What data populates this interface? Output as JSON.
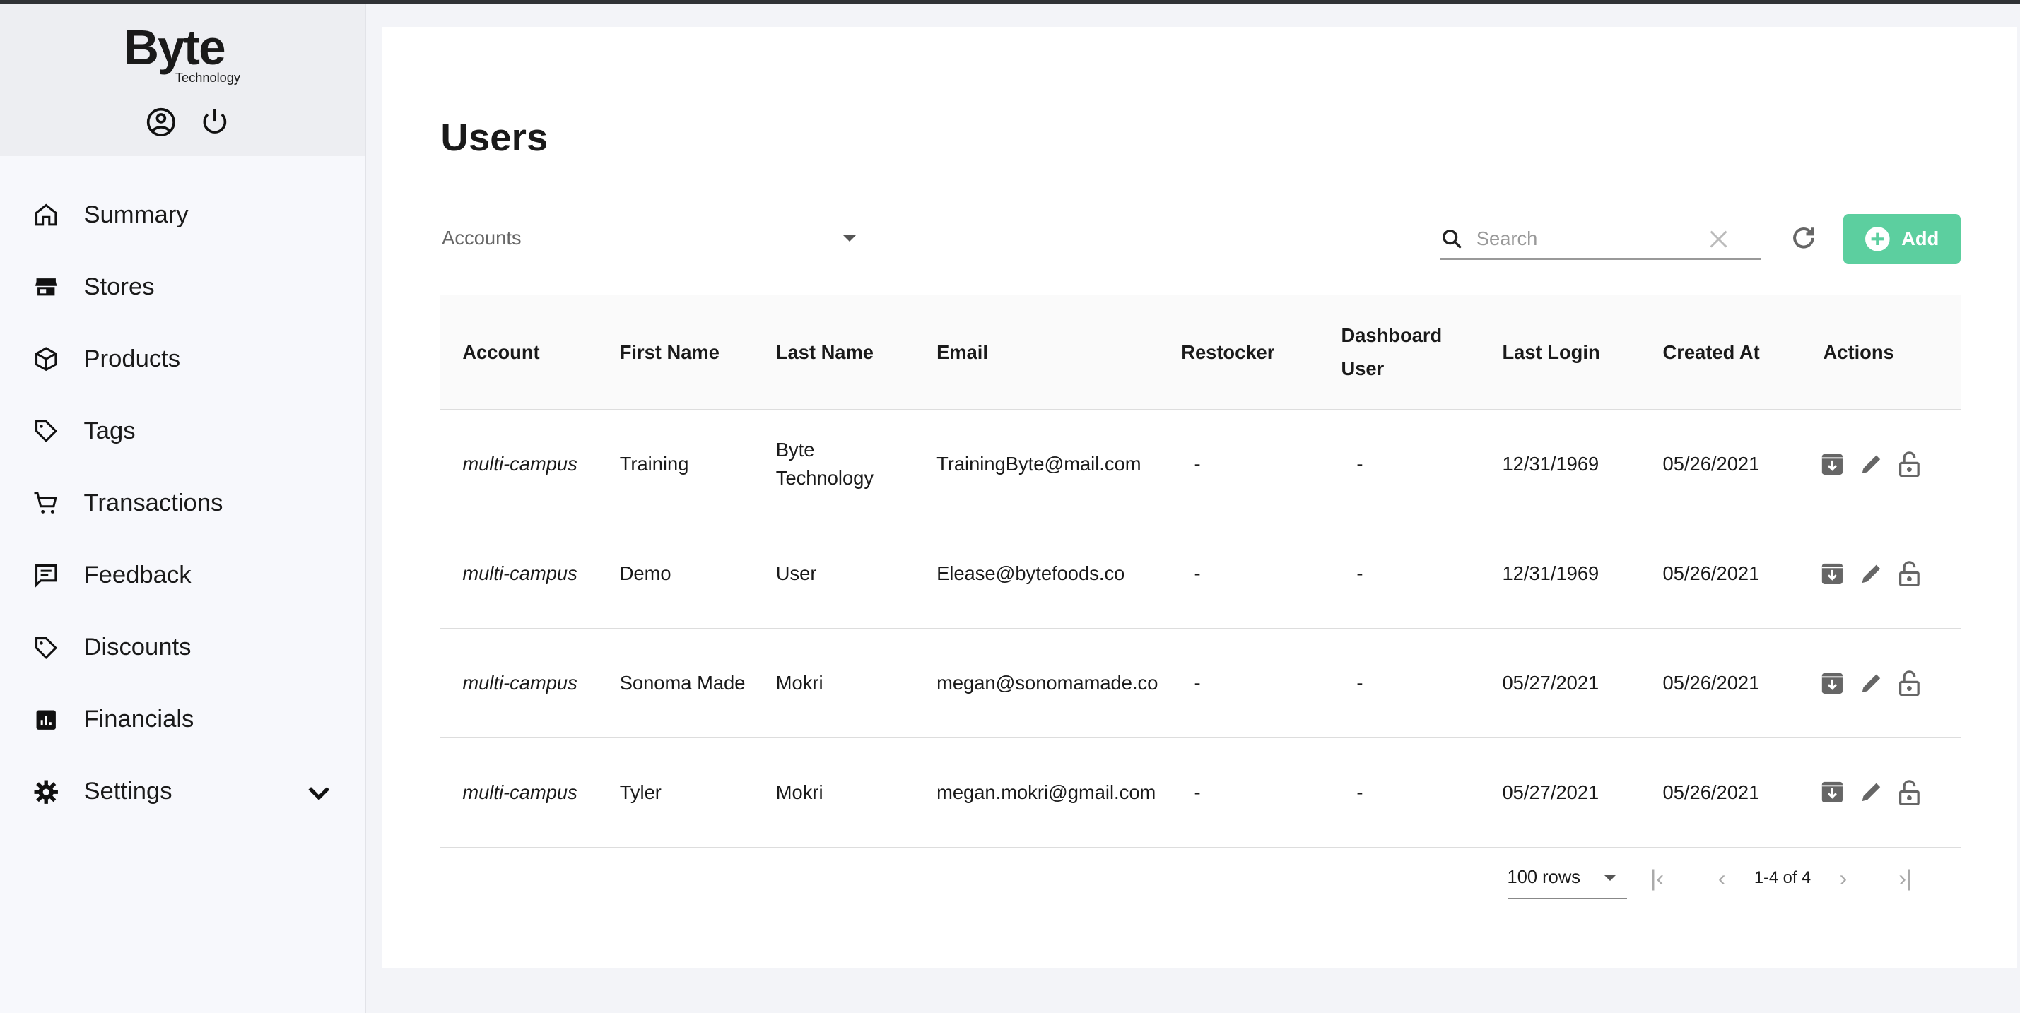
{
  "brand": {
    "name": "Byte",
    "sub": "Technology"
  },
  "sidebar": {
    "items": [
      {
        "label": "Summary",
        "icon": "home-icon"
      },
      {
        "label": "Stores",
        "icon": "store-icon"
      },
      {
        "label": "Products",
        "icon": "box-icon"
      },
      {
        "label": "Tags",
        "icon": "tag-icon"
      },
      {
        "label": "Transactions",
        "icon": "cart-icon"
      },
      {
        "label": "Feedback",
        "icon": "feedback-icon"
      },
      {
        "label": "Discounts",
        "icon": "tag-icon"
      },
      {
        "label": "Financials",
        "icon": "chart-icon"
      },
      {
        "label": "Settings",
        "icon": "gear-icon"
      }
    ]
  },
  "page": {
    "title": "Users"
  },
  "filters": {
    "accounts_label": "Accounts",
    "search_placeholder": "Search",
    "add_label": "Add",
    "accent": "#5ccf9f"
  },
  "table": {
    "headers": [
      "Account",
      "First Name",
      "Last Name",
      "Email",
      "Restocker",
      "Dashboard User",
      "Last Login",
      "Created At",
      "Actions"
    ],
    "rows": [
      {
        "account": "multi-campus",
        "first": "Training",
        "last": "Byte Technology",
        "email": "TrainingByte@mail.com",
        "restocker": "-",
        "dashboard": "-",
        "last_login": "12/31/1969",
        "created": "05/26/2021"
      },
      {
        "account": "multi-campus",
        "first": "Demo",
        "last": "User",
        "email": "Elease@bytefoods.co",
        "restocker": "-",
        "dashboard": "-",
        "last_login": "12/31/1969",
        "created": "05/26/2021"
      },
      {
        "account": "multi-campus",
        "first": "Sonoma Made",
        "last": "Mokri",
        "email": "megan@sonomamade.co",
        "restocker": "-",
        "dashboard": "-",
        "last_login": "05/27/2021",
        "created": "05/26/2021"
      },
      {
        "account": "multi-campus",
        "first": "Tyler",
        "last": "Mokri",
        "email": "megan.mokri@gmail.com",
        "restocker": "-",
        "dashboard": "-",
        "last_login": "05/27/2021",
        "created": "05/26/2021"
      }
    ]
  },
  "pagination": {
    "rows_per_page": "100 rows",
    "range": "1-4 of 4"
  }
}
